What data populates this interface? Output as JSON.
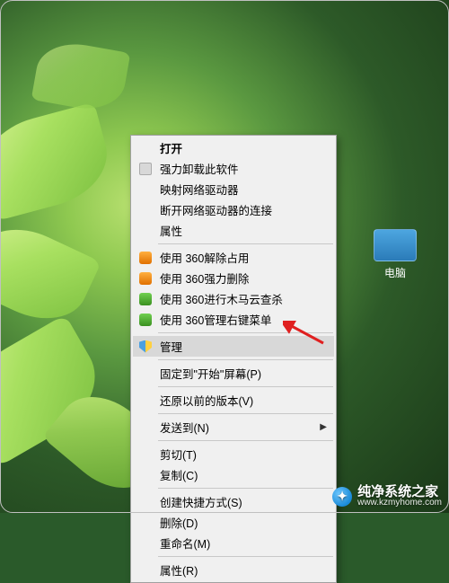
{
  "desktop": {
    "icon_label": "电脑"
  },
  "menu": {
    "groups": [
      [
        {
          "key": "open",
          "label": "打开",
          "bold": true
        },
        {
          "key": "uninstall",
          "label": "强力卸载此软件",
          "icon": "gray"
        },
        {
          "key": "map-drive",
          "label": "映射网络驱动器"
        },
        {
          "key": "disconnect-drive",
          "label": "断开网络驱动器的连接"
        },
        {
          "key": "properties-1",
          "label": "属性"
        }
      ],
      [
        {
          "key": "360-unlock",
          "label": "使用 360解除占用",
          "icon": "orange"
        },
        {
          "key": "360-force-delete",
          "label": "使用 360强力删除",
          "icon": "orange"
        },
        {
          "key": "360-scan",
          "label": "使用 360进行木马云查杀",
          "icon": "green"
        },
        {
          "key": "360-manage-menu",
          "label": "使用 360管理右键菜单",
          "icon": "green"
        }
      ],
      [
        {
          "key": "manage",
          "label": "管理",
          "icon": "shield",
          "highlighted": true
        }
      ],
      [
        {
          "key": "pin-start",
          "label": "固定到\"开始\"屏幕(P)"
        }
      ],
      [
        {
          "key": "restore-version",
          "label": "还原以前的版本(V)"
        }
      ],
      [
        {
          "key": "send-to",
          "label": "发送到(N)",
          "submenu": true
        }
      ],
      [
        {
          "key": "cut",
          "label": "剪切(T)"
        },
        {
          "key": "copy",
          "label": "复制(C)"
        }
      ],
      [
        {
          "key": "create-shortcut",
          "label": "创建快捷方式(S)"
        },
        {
          "key": "delete",
          "label": "删除(D)"
        },
        {
          "key": "rename",
          "label": "重命名(M)"
        }
      ],
      [
        {
          "key": "properties-2",
          "label": "属性(R)"
        }
      ]
    ]
  },
  "watermark": {
    "title": "纯净系统之家",
    "url": "www.kzmyhome.com"
  }
}
